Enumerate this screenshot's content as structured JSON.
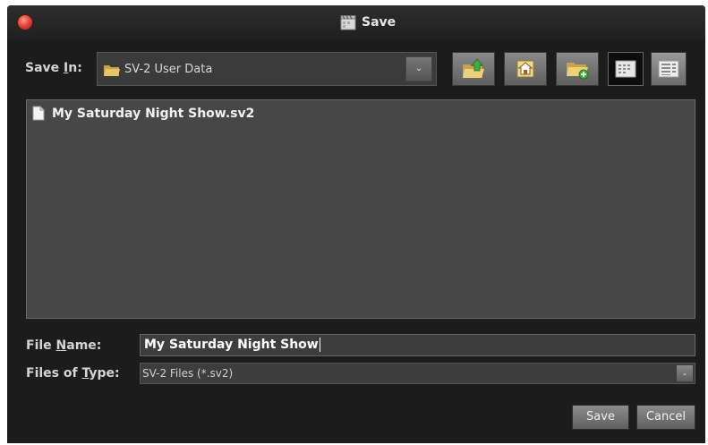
{
  "window": {
    "title": "Save"
  },
  "save_in": {
    "label_before": "Save ",
    "label_mnemonic": "I",
    "label_after": "n:",
    "value": "SV-2 User Data"
  },
  "files": [
    {
      "name": "My Saturday Night Show.sv2"
    }
  ],
  "file_name": {
    "label_before": "File ",
    "label_mnemonic": "N",
    "label_after": "ame:",
    "value": "My Saturday Night Show"
  },
  "files_of_type": {
    "label_before": "Files of ",
    "label_mnemonic": "T",
    "label_after": "ype:",
    "value": "SV-2 Files (*.sv2)"
  },
  "buttons": {
    "save": "Save",
    "cancel": "Cancel"
  },
  "toolbar": {
    "icons": [
      "up-folder-icon",
      "home-icon",
      "new-folder-icon",
      "list-view-icon",
      "details-view-icon"
    ]
  },
  "colors": {
    "window_bg": "#1c1c1c",
    "list_bg": "#474747",
    "folder": "#e5c46a",
    "green": "#3fae3f"
  }
}
